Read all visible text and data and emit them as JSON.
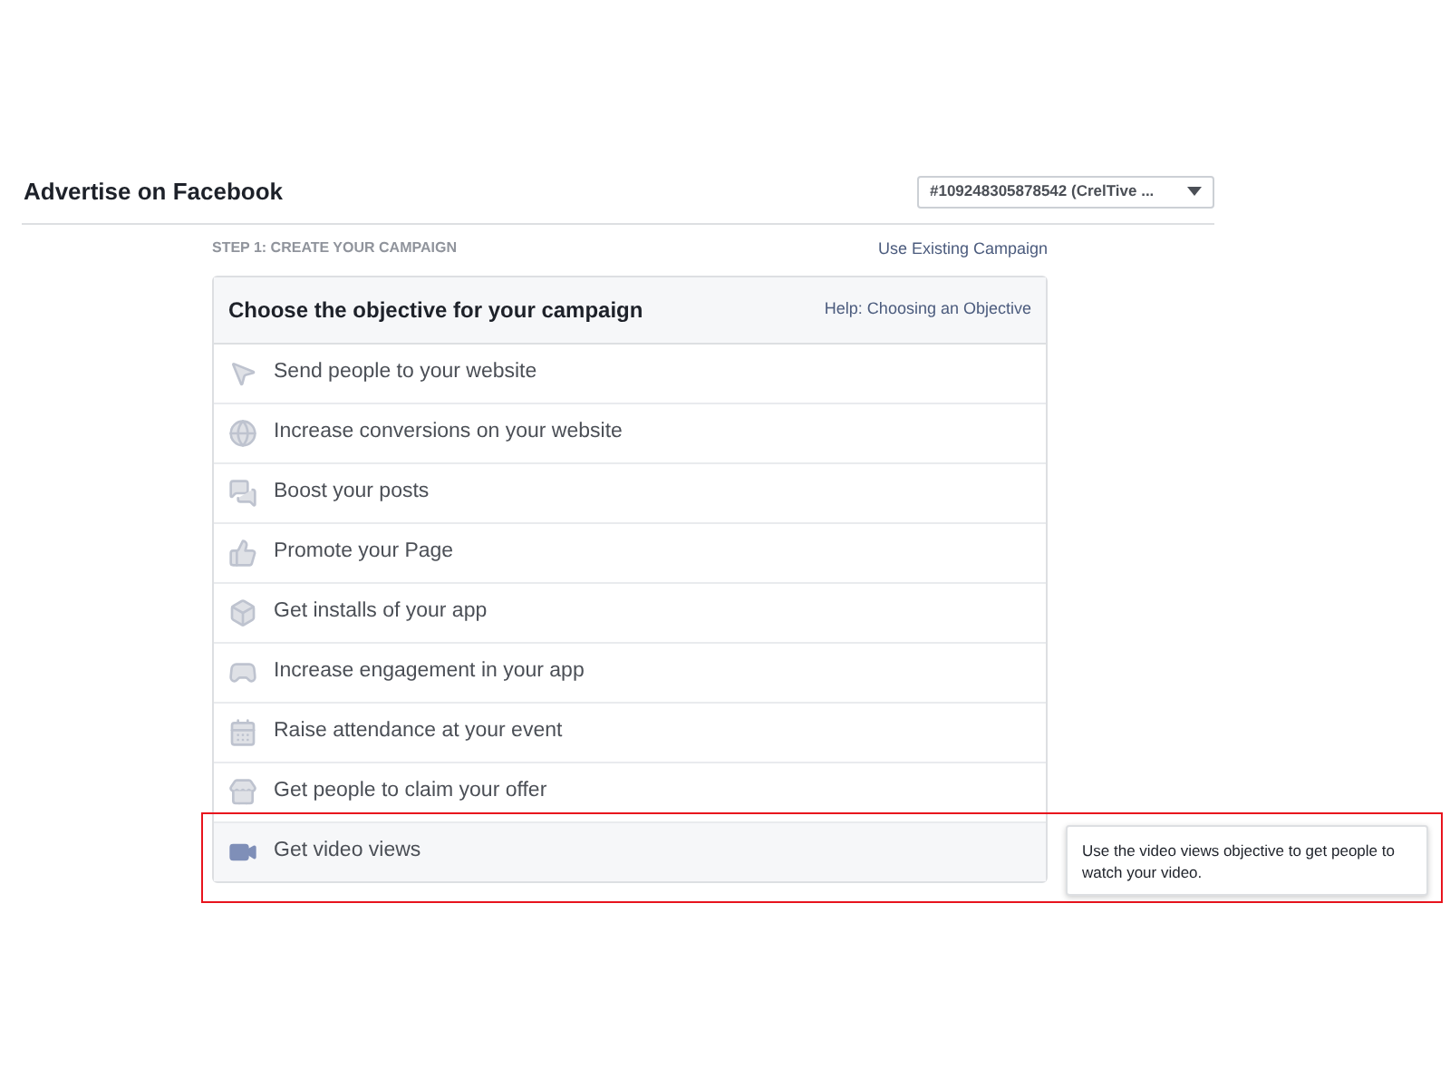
{
  "header": {
    "title": "Advertise on Facebook",
    "account_select": "#109248305878542 (CrelTive ..."
  },
  "step": {
    "label": "STEP 1: CREATE YOUR CAMPAIGN",
    "link": "Use Existing Campaign"
  },
  "objective_card": {
    "title": "Choose the objective for your campaign",
    "help_link": "Help: Choosing an Objective",
    "items": [
      {
        "label": "Send people to your website",
        "selected": false,
        "highlighted": false
      },
      {
        "label": "Increase conversions on your website",
        "selected": false,
        "highlighted": false
      },
      {
        "label": "Boost your posts",
        "selected": false,
        "highlighted": false
      },
      {
        "label": "Promote your Page",
        "selected": false,
        "highlighted": false
      },
      {
        "label": "Get installs of your app",
        "selected": false,
        "highlighted": false
      },
      {
        "label": "Increase engagement in your app",
        "selected": false,
        "highlighted": false
      },
      {
        "label": "Raise attendance at your event",
        "selected": false,
        "highlighted": false
      },
      {
        "label": "Get people to claim your offer",
        "selected": false,
        "highlighted": false
      },
      {
        "label": "Get video views",
        "selected": true,
        "highlighted": true,
        "tooltip": "Use the video views objective to get people to watch your video."
      }
    ]
  }
}
